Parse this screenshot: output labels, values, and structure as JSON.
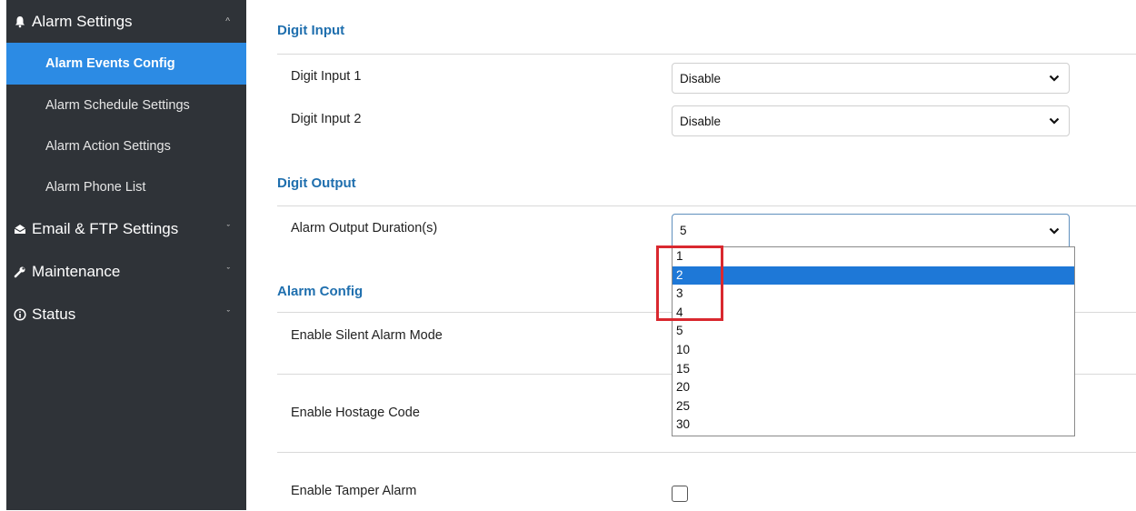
{
  "sidebar": {
    "groups": [
      {
        "label": "Alarm Settings",
        "icon": "bell-icon",
        "chevron": "^"
      },
      {
        "label": "Email & FTP Settings",
        "icon": "mail-icon",
        "chevron": "ˇ"
      },
      {
        "label": "Maintenance",
        "icon": "wrench-icon",
        "chevron": "ˇ"
      },
      {
        "label": "Status",
        "icon": "info-icon",
        "chevron": "ˇ"
      }
    ],
    "items": [
      {
        "label": "Alarm Events Config",
        "active": true
      },
      {
        "label": "Alarm Schedule Settings"
      },
      {
        "label": "Alarm Action Settings"
      },
      {
        "label": "Alarm Phone List"
      }
    ]
  },
  "main": {
    "digit_input": {
      "title": "Digit Input",
      "rows": [
        {
          "label": "Digit Input 1",
          "value": "Disable"
        },
        {
          "label": "Digit Input 2",
          "value": "Disable"
        }
      ]
    },
    "digit_output": {
      "title": "Digit Output",
      "rows": [
        {
          "label": "Alarm Output Duration(s)",
          "value": "5"
        }
      ],
      "dropdown_options": [
        "1",
        "2",
        "3",
        "4",
        "5",
        "10",
        "15",
        "20",
        "25",
        "30"
      ],
      "dropdown_highlighted": "2"
    },
    "alarm_config": {
      "title": "Alarm Config",
      "rows": [
        {
          "label": "Enable Silent Alarm Mode"
        },
        {
          "label": "Enable Hostage Code"
        },
        {
          "label": "Enable Tamper Alarm",
          "checked": false
        }
      ]
    }
  },
  "colors": {
    "sidebar_bg": "#2f3338",
    "active_item_bg": "#2c8be4",
    "section_title": "#1f6fae",
    "option_selected_bg": "#1e78d7",
    "annotation_box": "#d9282f"
  }
}
